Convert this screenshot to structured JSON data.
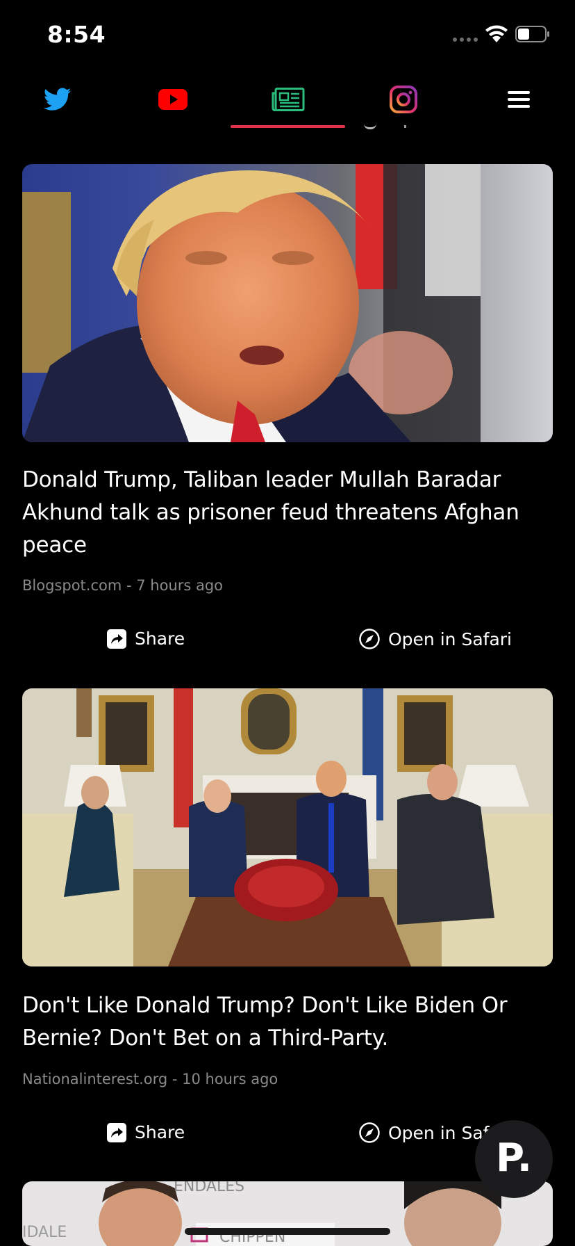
{
  "status_bar": {
    "time": "8:54"
  },
  "tabs": [
    {
      "icon": "twitter-icon",
      "color": "#1da1f2",
      "selected": false
    },
    {
      "icon": "youtube-icon",
      "color": "#ff0000",
      "selected": false
    },
    {
      "icon": "news-icon",
      "color": "#2bbd7e",
      "selected": true
    },
    {
      "icon": "instagram-icon",
      "color": "#c13584",
      "selected": false
    },
    {
      "icon": "menu-icon",
      "color": "#ffffff",
      "selected": false
    }
  ],
  "accent_color": "#e0314b",
  "articles": [
    {
      "title": "Donald Trump, Taliban leader Mullah Baradar Akhund talk as prisoner feud threatens Afghan peace",
      "source": "Blogspot.com",
      "time": "7 hours ago",
      "meta": "Blogspot.com - 7 hours ago",
      "share_label": "Share",
      "open_label": "Open in Safari"
    },
    {
      "title": "Don't Like Donald Trump? Don't Like Biden Or Bernie? Don't Bet on a Third-Party.",
      "source": "Nationalinterest.org",
      "time": "10 hours ago",
      "meta": "Nationalinterest.org - 10 hours ago",
      "share_label": "Share",
      "open_label": "Open in Safari"
    },
    {
      "partial_image_text_1": "ENDALES",
      "partial_image_text_2": "IDALE",
      "partial_image_text_3": "CHIPPEN"
    }
  ],
  "fab": {
    "letter": "P."
  }
}
